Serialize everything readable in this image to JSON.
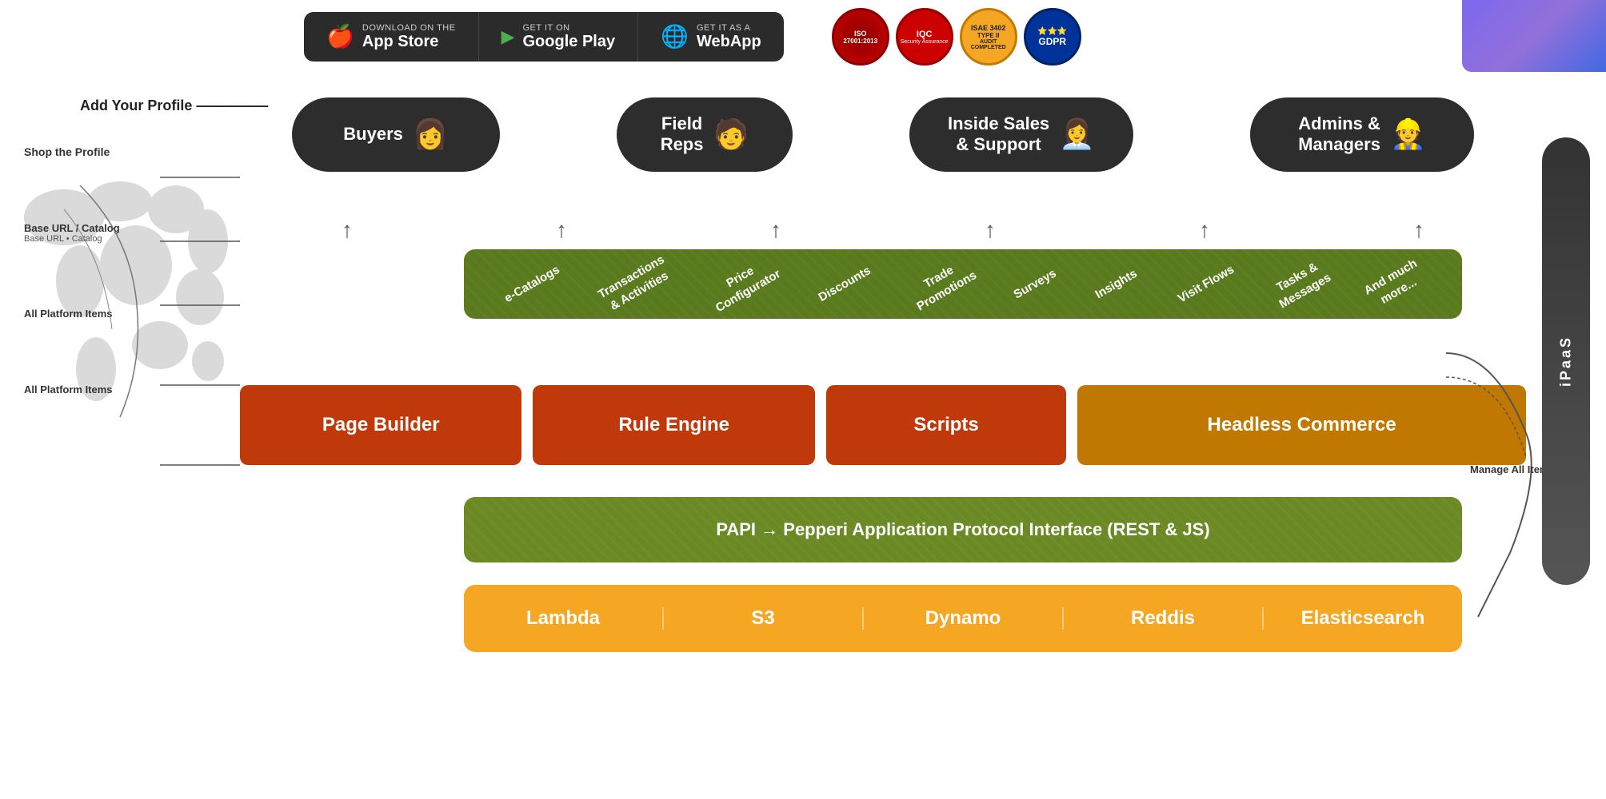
{
  "topbar": {
    "stores": [
      {
        "id": "appstore",
        "small_text": "Download on the",
        "big_text": "App Store",
        "icon": "🍎"
      },
      {
        "id": "googleplay",
        "small_text": "GET IT ON",
        "big_text": "Google Play",
        "icon": "▶"
      },
      {
        "id": "webapp",
        "small_text": "Get it as a",
        "big_text": "WebApp",
        "icon": "🌐"
      }
    ],
    "badges": [
      {
        "id": "iso",
        "text": "ISO 27001:2013",
        "bg": "#c00020"
      },
      {
        "id": "iqa",
        "text": "IQC",
        "bg": "#cc0000"
      },
      {
        "id": "isae",
        "text": "ISAE 3402\nTYPE II",
        "bg": "#f5a623"
      },
      {
        "id": "gdpr",
        "text": "GDPR",
        "bg": "#003399"
      }
    ]
  },
  "personas": [
    {
      "id": "buyers",
      "label": "Buyers",
      "icon": "👩"
    },
    {
      "id": "fieldreps",
      "label": "Field\nReps",
      "icon": "🧑"
    },
    {
      "id": "insidesales",
      "label": "Inside Sales\n& Support",
      "icon": "👩‍💼"
    },
    {
      "id": "admins",
      "label": "Admins &\nManagers",
      "icon": "👷"
    }
  ],
  "features": [
    "e-Catalogs",
    "Transactions\n& Activities",
    "Price\nConfigurator",
    "Discounts",
    "Trade\nPromotions",
    "Surveys",
    "Insights",
    "Visit Flows",
    "Tasks &\nMessages",
    "And much\nmore..."
  ],
  "middle_blocks": {
    "page_builder": "Page Builder",
    "rule_engine": "Rule Engine",
    "scripts": "Scripts",
    "headless_commerce": "Headless Commerce"
  },
  "papi": {
    "label": "PAPI → Pepperi Application Protocol Interface (REST & JS)"
  },
  "infrastructure": [
    "Lambda",
    "S3",
    "Dynamo",
    "Reddis",
    "Elasticsearch"
  ],
  "ipaas": {
    "label": "iPaaS"
  },
  "left_labels": {
    "title": "Add Your Profile",
    "items": [
      {
        "main": "Shop the Profile",
        "sub": ""
      },
      {
        "main": "Base URL / Catalog",
        "sub": ""
      },
      {
        "main": "",
        "sub": ""
      },
      {
        "main": "All Platform Items",
        "sub": ""
      },
      {
        "main": "All Platform Items",
        "sub": ""
      }
    ]
  },
  "right_label": "Manage All Items"
}
